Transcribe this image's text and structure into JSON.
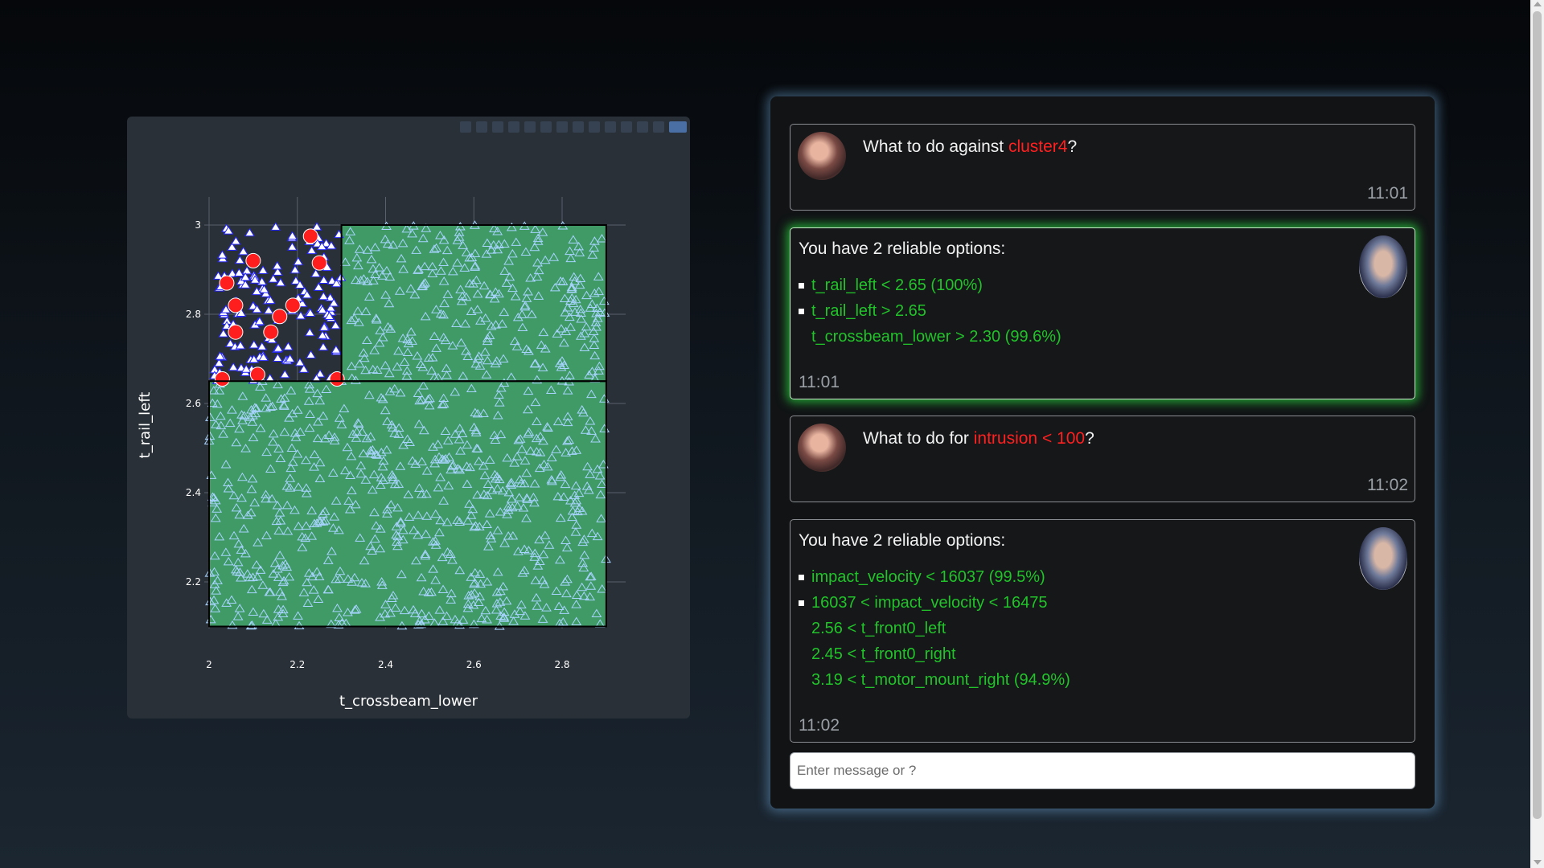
{
  "plot": {
    "x_axis_title": "t_crossbeam_lower",
    "y_axis_title": "t_rail_left",
    "modebar_icons": [
      "camera-icon",
      "edit-icon",
      "zoom-icon",
      "pan-icon",
      "box-select-icon",
      "lasso-icon",
      "zoom-in-icon",
      "zoom-out-icon",
      "autoscale-icon",
      "reset-axes-icon",
      "spike-icon",
      "hover-closest-icon",
      "hover-compare-icon",
      "plotly-logo-icon"
    ],
    "colors": {
      "panel_bg": "#2a3038",
      "region_fill": "#3f9a66",
      "region_border": "#000000",
      "triangle_stroke": "#2424ff",
      "triangle_stroke_in_region": "#a8d4ff",
      "circle_fill": "#ff1e1e"
    }
  },
  "chart_data": {
    "type": "scatter",
    "xlabel": "t_crossbeam_lower",
    "ylabel": "t_rail_left",
    "xlim": [
      2.0,
      2.9
    ],
    "ylim": [
      2.1,
      3.0
    ],
    "x_ticks": [
      "2",
      "2.2",
      "2.4",
      "2.6",
      "2.8"
    ],
    "y_ticks": [
      "2.2",
      "2.4",
      "2.6",
      "2.8",
      "3"
    ],
    "grid": true,
    "regions": [
      {
        "x": [
          2.0,
          2.9
        ],
        "y": [
          2.1,
          2.65
        ]
      },
      {
        "x": [
          2.3,
          2.9
        ],
        "y": [
          2.65,
          3.0
        ]
      }
    ],
    "series": [
      {
        "marker": "circle",
        "points": [
          [
            2.23,
            2.975
          ],
          [
            2.1,
            2.92
          ],
          [
            2.25,
            2.915
          ],
          [
            2.04,
            2.87
          ],
          [
            2.06,
            2.82
          ],
          [
            2.19,
            2.82
          ],
          [
            2.16,
            2.795
          ],
          [
            2.06,
            2.76
          ],
          [
            2.14,
            2.76
          ],
          [
            2.03,
            2.655
          ],
          [
            2.11,
            2.665
          ],
          [
            2.29,
            2.655
          ]
        ]
      },
      {
        "marker": "triangle",
        "count_approx": 1100,
        "x_range": [
          2.0,
          2.9
        ],
        "y_range": [
          2.1,
          3.0
        ]
      }
    ]
  },
  "chat": {
    "messages": [
      {
        "role": "user",
        "text_before": "What to do against ",
        "highlight": "cluster4",
        "text_after": "?",
        "time": "11:01"
      },
      {
        "role": "bot",
        "title": "You have 2 reliable options:",
        "options": [
          "t_rail_left < 2.65 (100%)",
          "t_rail_left > 2.65",
          "t_crossbeam_lower > 2.30 (99.6%)"
        ],
        "time": "11:01"
      },
      {
        "role": "user",
        "text_before": "What to do for ",
        "highlight": "intrusion < 100",
        "text_after": "?",
        "time": "11:02"
      },
      {
        "role": "bot",
        "title": "You have 2 reliable options:",
        "options": [
          "impact_velocity < 16037 (99.5%)",
          "16037 < impact_velocity < 16475",
          "2.56 < t_front0_left",
          "2.45 < t_front0_right",
          "3.19 < t_motor_mount_right (94.9%)"
        ],
        "time": "11:02"
      }
    ],
    "input_placeholder": "Enter message or ?"
  }
}
